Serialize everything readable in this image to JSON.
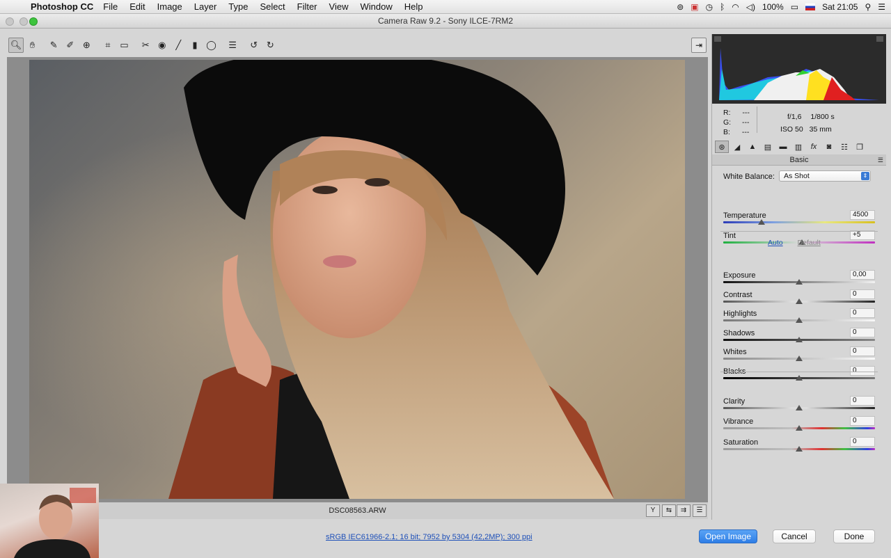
{
  "menubar": {
    "apple": "",
    "app": "Photoshop CC",
    "items": [
      "File",
      "Edit",
      "Image",
      "Layer",
      "Type",
      "Select",
      "Filter",
      "View",
      "Window",
      "Help"
    ],
    "battery": "100%",
    "clock": "Sat 21:05"
  },
  "window": {
    "title": "Camera Raw 9.2  -  Sony ILCE-7RM2"
  },
  "toolbar": {
    "tools": [
      "zoom-tool-icon",
      "hand-tool-icon",
      "white-balance-tool-icon",
      "color-sampler-tool-icon",
      "targeted-adjustment-tool-icon",
      "crop-tool-icon",
      "straighten-tool-icon",
      "spot-removal-tool-icon",
      "red-eye-tool-icon",
      "adjustment-brush-icon",
      "graduated-filter-icon",
      "radial-filter-icon",
      "preferences-icon",
      "rotate-left-icon",
      "rotate-right-icon"
    ]
  },
  "image": {
    "filename": "DSC08563.ARW"
  },
  "readout": {
    "r_label": "R:",
    "r_val": "---",
    "g_label": "G:",
    "g_val": "---",
    "b_label": "B:",
    "b_val": "---",
    "aperture": "f/1,6",
    "shutter": "1/800 s",
    "iso": "ISO 50",
    "focal": "35 mm"
  },
  "panel": {
    "tabs": [
      "basic-tab-icon",
      "tone-curve-tab-icon",
      "detail-tab-icon",
      "hsl-tab-icon",
      "split-toning-tab-icon",
      "lens-corrections-tab-icon",
      "effects-tab-icon",
      "camera-calibration-tab-icon",
      "presets-tab-icon",
      "snapshots-tab-icon"
    ],
    "section": "Basic",
    "wb_label": "White Balance:",
    "wb_value": "As Shot",
    "auto": "Auto",
    "default": "Default",
    "sliders": [
      {
        "label": "Temperature",
        "value": "4500",
        "pos": 0.25
      },
      {
        "label": "Tint",
        "value": "+5",
        "pos": 0.52
      },
      {
        "label": "Exposure",
        "value": "0,00",
        "pos": 0.5
      },
      {
        "label": "Contrast",
        "value": "0",
        "pos": 0.5
      },
      {
        "label": "Highlights",
        "value": "0",
        "pos": 0.5
      },
      {
        "label": "Shadows",
        "value": "0",
        "pos": 0.5
      },
      {
        "label": "Whites",
        "value": "0",
        "pos": 0.5
      },
      {
        "label": "Blacks",
        "value": "0",
        "pos": 0.5
      },
      {
        "label": "Clarity",
        "value": "0",
        "pos": 0.5
      },
      {
        "label": "Vibrance",
        "value": "0",
        "pos": 0.5
      },
      {
        "label": "Saturation",
        "value": "0",
        "pos": 0.5
      }
    ]
  },
  "footer": {
    "workflow": "sRGB IEC61966-2.1; 16 bit; 7952 by 5304 (42,2MP); 300 ppi",
    "open": "Open Image",
    "cancel": "Cancel",
    "done": "Done"
  }
}
